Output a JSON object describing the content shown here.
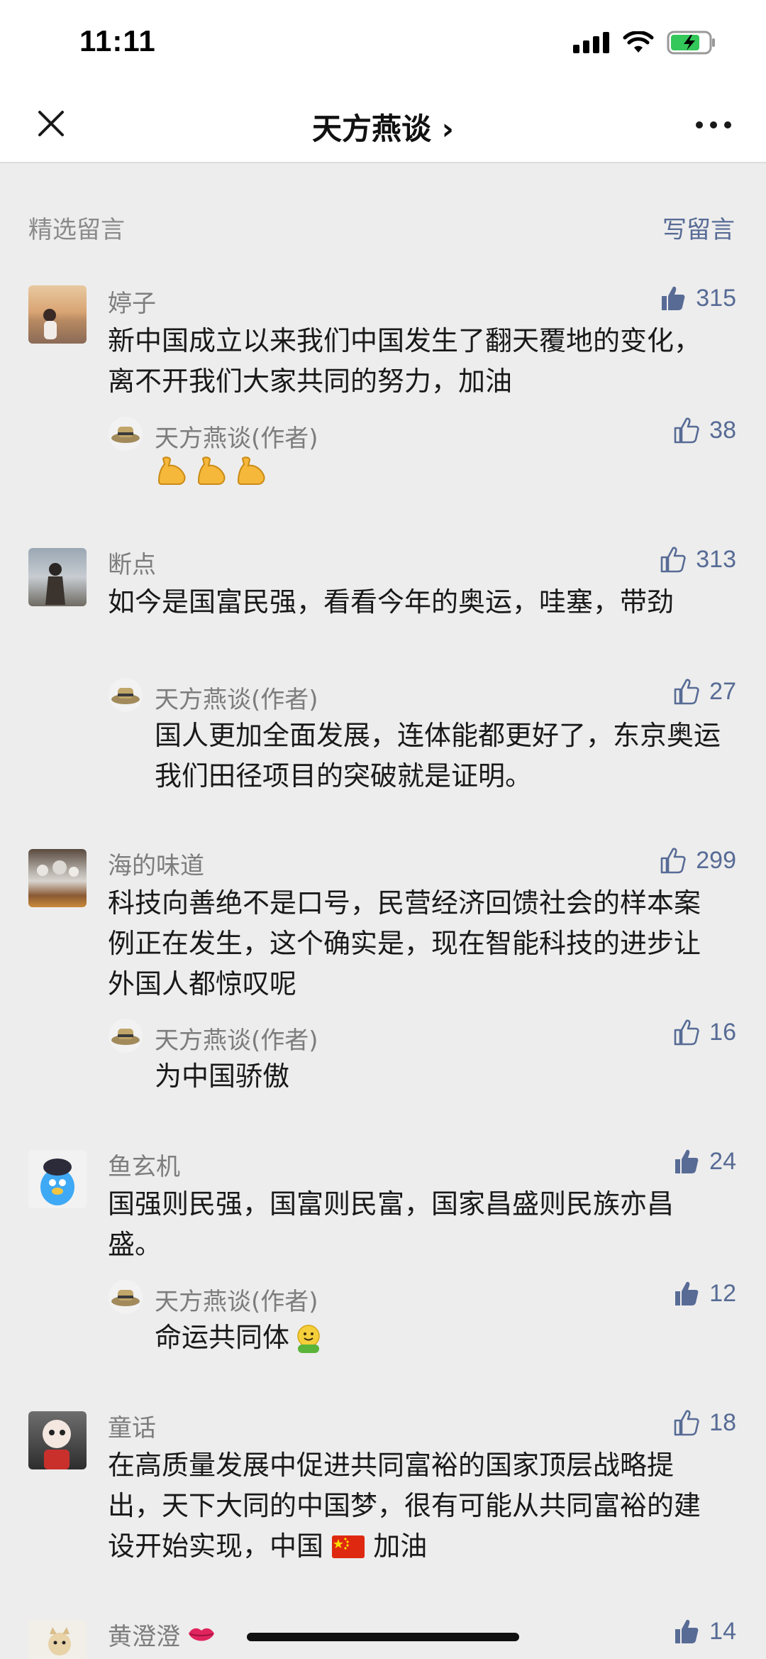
{
  "status": {
    "time": "11:11"
  },
  "nav": {
    "title": "天方燕谈 ›"
  },
  "section": {
    "title": "精选留言",
    "write": "写留言"
  },
  "comments": [
    {
      "name": "婷子",
      "likes": "315",
      "liked": true,
      "text": "新中国成立以来我们中国发生了翻天覆地的变化，离不开我们大家共同的努力，加油",
      "reply": {
        "name": "天方燕谈(作者)",
        "likes": "38",
        "liked": false,
        "text": ""
      }
    },
    {
      "name": "断点",
      "likes": "313",
      "liked": false,
      "text": "如今是国富民强，看看今年的奥运，哇塞，带劲",
      "reply": {
        "name": "天方燕谈(作者)",
        "likes": "27",
        "liked": false,
        "text": "国人更加全面发展，连体能都更好了，东京奥运我们田径项目的突破就是证明。"
      }
    },
    {
      "name": "海的味道",
      "likes": "299",
      "liked": false,
      "text": "科技向善绝不是口号，民营经济回馈社会的样本案例正在发生，这个确实是，现在智能科技的进步让外国人都惊叹呢",
      "reply": {
        "name": "天方燕谈(作者)",
        "likes": "16",
        "liked": false,
        "text": "为中国骄傲"
      }
    },
    {
      "name": "鱼玄机",
      "likes": "24",
      "liked": true,
      "text": "国强则民强，国富则民富，国家昌盛则民族亦昌盛。",
      "reply": {
        "name": "天方燕谈(作者)",
        "likes": "12",
        "liked": true,
        "text": "命运共同体"
      }
    },
    {
      "name": "童话",
      "likes": "18",
      "liked": false,
      "text": "在高质量发展中促进共同富裕的国家顶层战略提出，天下大同的中国梦，很有可能从共同富裕的建设开始实现，中国",
      "text_suffix": "加油"
    },
    {
      "name": "黄澄澄",
      "likes": "14",
      "liked": true
    }
  ],
  "colors": {
    "link": "#576b95",
    "muted": "#7d7d7d",
    "background": "#ededed"
  },
  "icons": [
    "close-icon",
    "more-icon",
    "thumb-up-icon",
    "signal-icon",
    "wifi-icon",
    "battery-icon"
  ]
}
